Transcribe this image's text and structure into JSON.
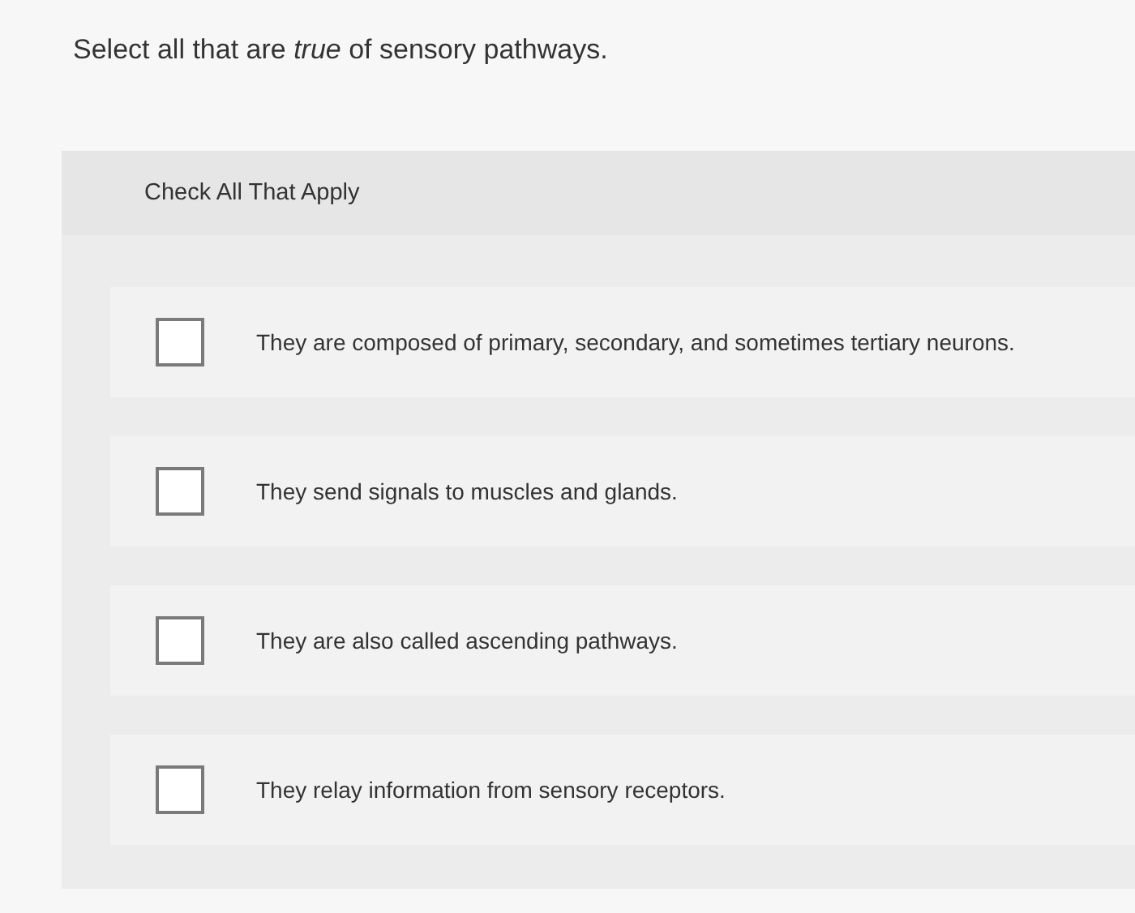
{
  "question": "Select all that are *true* of sensory pathways.",
  "instruction": "Check All That Apply",
  "options": [
    {
      "label": "They are composed of primary, secondary, and sometimes tertiary neurons.",
      "checked": false
    },
    {
      "label": "They send signals to muscles and glands.",
      "checked": false
    },
    {
      "label": "They are also called ascending pathways.",
      "checked": false
    },
    {
      "label": "They relay information from sensory receptors.",
      "checked": false
    }
  ]
}
